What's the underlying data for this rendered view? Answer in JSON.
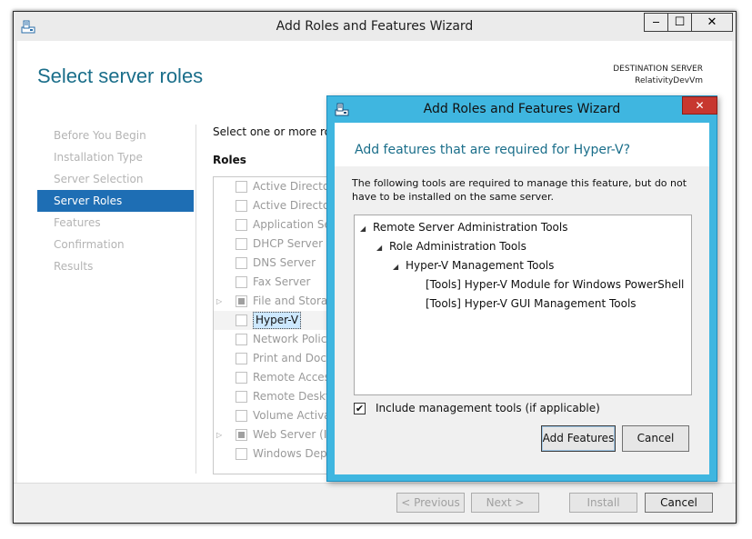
{
  "main_window": {
    "title": "Add Roles and Features Wizard",
    "controls": {
      "minimize": "‒",
      "maximize": "☐",
      "close": "✕"
    }
  },
  "page": {
    "title": "Select server roles",
    "destination_label": "DESTINATION SERVER",
    "destination_name": "RelativityDevVm"
  },
  "nav": {
    "items": [
      {
        "label": "Before You Begin",
        "active": false
      },
      {
        "label": "Installation Type",
        "active": false
      },
      {
        "label": "Server Selection",
        "active": false
      },
      {
        "label": "Server Roles",
        "active": true
      },
      {
        "label": "Features",
        "active": false
      },
      {
        "label": "Confirmation",
        "active": false
      },
      {
        "label": "Results",
        "active": false
      }
    ]
  },
  "roles": {
    "instruction": "Select one or more roles",
    "heading": "Roles",
    "items": [
      {
        "label": "Active Directory"
      },
      {
        "label": "Active Directory"
      },
      {
        "label": "Application Serv"
      },
      {
        "label": "DHCP Server"
      },
      {
        "label": "DNS Server"
      },
      {
        "label": "Fax Server"
      },
      {
        "label": "File and Storage"
      },
      {
        "label": "Hyper-V"
      },
      {
        "label": "Network Policy"
      },
      {
        "label": "Print and Docu"
      },
      {
        "label": "Remote Access"
      },
      {
        "label": "Remote Deskto"
      },
      {
        "label": "Volume Activati"
      },
      {
        "label": "Web Server (IIS"
      },
      {
        "label": "Windows Deplo"
      }
    ]
  },
  "footer": {
    "previous": "< Previous",
    "next": "Next >",
    "install": "Install",
    "cancel": "Cancel"
  },
  "dialog": {
    "title": "Add Roles and Features Wizard",
    "close": "✕",
    "heading": "Add features that are required for Hyper-V?",
    "description": "The following tools are required to manage this feature, but do not have to be installed on the same server.",
    "tree": [
      {
        "label": "Remote Server Administration Tools",
        "expander": "◢"
      },
      {
        "label": "Role Administration Tools",
        "expander": "◢"
      },
      {
        "label": "Hyper-V Management Tools",
        "expander": "◢"
      },
      {
        "label": "[Tools] Hyper-V Module for Windows PowerShell",
        "expander": ""
      },
      {
        "label": "[Tools] Hyper-V GUI Management Tools",
        "expander": ""
      }
    ],
    "include_label": "Include management tools (if applicable)",
    "include_checked": "✔",
    "add_button": "Add Features",
    "cancel_button": "Cancel"
  },
  "colors": {
    "accent_blue": "#1e6eb4",
    "title_teal": "#1a6e8a",
    "dialog_frame": "#3fb6e0",
    "close_red": "#c7372f"
  }
}
